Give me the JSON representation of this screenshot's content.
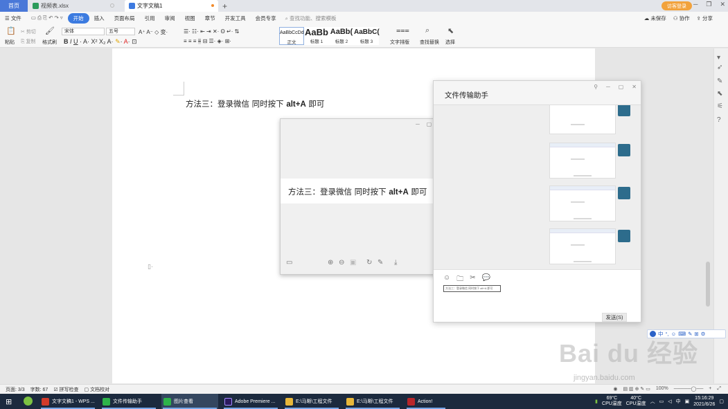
{
  "tabs": {
    "home": "首页",
    "tab1": "视频表.xlsx",
    "tab2": "文字文稿1"
  },
  "titlebar": {
    "login": "访客登录"
  },
  "menubar": {
    "file": "文件",
    "items": [
      "开始",
      "插入",
      "页面布局",
      "引用",
      "审阅",
      "视图",
      "章节",
      "开发工具",
      "会员专享"
    ],
    "search": "查找功能、搜索模板",
    "unsaved": "未保存",
    "collab": "协作",
    "share": "分享"
  },
  "ribbon": {
    "paste": "粘贴",
    "cut": "剪切",
    "copy": "复制",
    "format_painter": "格式刷",
    "font": "宋体",
    "size": "五号",
    "styles": [
      {
        "preview": "AaBbCcDd",
        "label": "正文"
      },
      {
        "preview": "AaBb",
        "label": "标题 1"
      },
      {
        "preview": "AaBb(",
        "label": "标题 2"
      },
      {
        "preview": "AaBbC(",
        "label": "标题 3"
      }
    ],
    "text_layout": "文字排版",
    "find_replace": "查找替换",
    "select": "选择"
  },
  "document": {
    "line_cn": "方法三：登录微信  同时按下",
    "line_key": "alt+A",
    "line_end": "即可"
  },
  "viewer": {
    "line_cn": "方法三：登录微信  同时按下",
    "line_key": "alt+A",
    "line_end": "即可"
  },
  "fta": {
    "title": "文件传输助手",
    "tooltip": "方法三：登录微信 同时按下 alt+A 即可",
    "send": "发送(S)"
  },
  "ime": [
    "中",
    "°,",
    "☺",
    "⌨",
    "✎",
    "⊞",
    "⚙"
  ],
  "watermark": {
    "main": "Bai du 经验",
    "sub": "jingyan.baidu.com"
  },
  "statusbar": {
    "page": "页面: 3/3",
    "words": "字数: 67",
    "spell": "拼写检查",
    "proof": "文档校对",
    "zoom": "100%"
  },
  "taskbar": {
    "apps": [
      {
        "label": "文字文稿1 - WPS ...",
        "color": "#d23a2a"
      },
      {
        "label": "文件传输助手",
        "color": "#2eb34a"
      },
      {
        "label": "图片查看",
        "color": "#2eb34a"
      },
      {
        "label": "Adobe Premiere ...",
        "color": "#2b1a5e"
      },
      {
        "label": "E:\\马晰\\工程文件",
        "color": "#e8b73a"
      },
      {
        "label": "E:\\马晰\\工程文件",
        "color": "#e8b73a"
      },
      {
        "label": "Action!",
        "color": "#b8262a"
      }
    ],
    "temp_gpu_val": "69°C",
    "temp_gpu_label": "CPU温度",
    "temp_cpu_val": "40°C",
    "temp_cpu_label": "CPU温度",
    "ime": "中",
    "time": "15:16:29",
    "date": "2021/6/26"
  }
}
